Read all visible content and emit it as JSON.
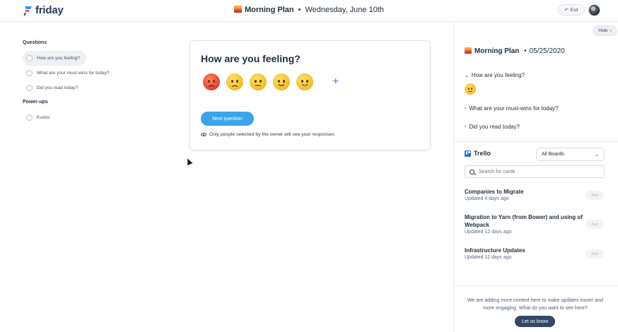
{
  "header": {
    "logo_text": "friday",
    "plan_title": "Morning Plan",
    "separator": "•",
    "date": "Wednesday, June 10th",
    "exit_label": "Exit"
  },
  "sidebar_left": {
    "questions_heading": "Questions",
    "questions": [
      {
        "label": "How are you feeling?",
        "active": true
      },
      {
        "label": "What are your must-wins for today?",
        "active": false
      },
      {
        "label": "Did you read today?",
        "active": false
      }
    ],
    "powerups_heading": "Power-ups",
    "powerups": [
      {
        "label": "Kudos"
      }
    ]
  },
  "question_card": {
    "title": "How are you feeling?",
    "emojis": [
      "angry-face-icon",
      "frowning-face-icon",
      "neutral-face-icon",
      "slightly-smiling-face-icon",
      "grinning-face-icon"
    ],
    "add_symbol": "+",
    "next_label": "Next question",
    "privacy_text": "Only people selected by the owner will see your responses"
  },
  "right_panel": {
    "hide_label": "Hide",
    "plan_title": "Morning Plan",
    "separator": "•",
    "date": "05/25/2020",
    "questions": [
      {
        "label": "How are you feeling?",
        "expanded": true
      },
      {
        "label": "What are your must-wins for today?",
        "expanded": false
      },
      {
        "label": "Did you read today?",
        "expanded": false
      }
    ],
    "trello": {
      "title": "Trello",
      "board_select": "All Boards",
      "search_placeholder": "Search for cards",
      "cards": [
        {
          "name": "Companies to Migrate",
          "updated": "Updated 4 days ago",
          "add": "Add"
        },
        {
          "name": "Migration to Yarn (from Bower) and using of Webpack",
          "updated": "Updated 12 days ago",
          "add": "Add"
        },
        {
          "name": "Infrastructure Updates",
          "updated": "Updated 12 days ago",
          "add": "Add"
        }
      ]
    },
    "footer_text": "We are adding more context here to make updates easier and more engaging. What do you want to see here?",
    "footer_button": "Let us know"
  },
  "colors": {
    "accent": "#3ba4ec",
    "dark_button": "#34466a",
    "trello_blue": "#1f6fd8"
  }
}
